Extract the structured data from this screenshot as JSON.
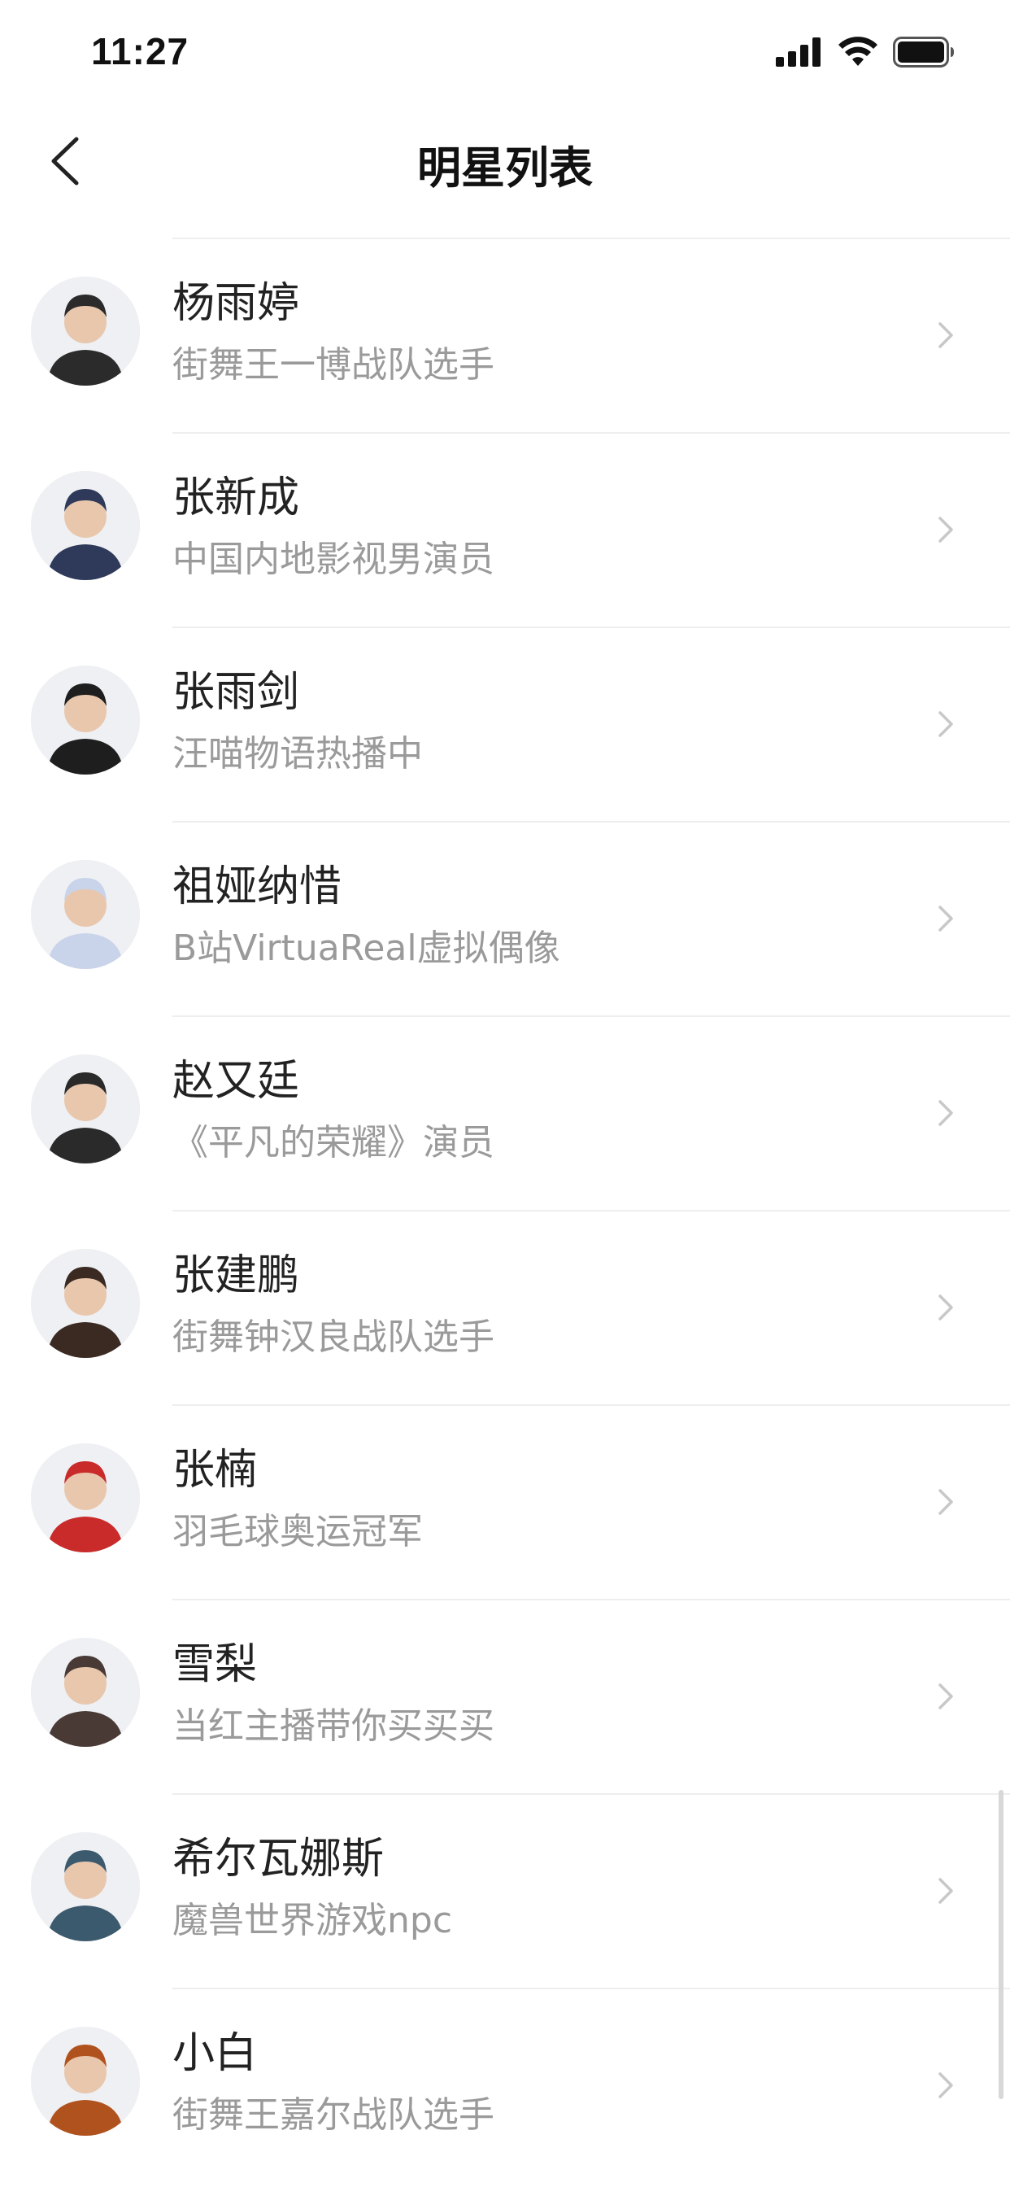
{
  "status_bar": {
    "time": "11:27",
    "icons": [
      "signal-icon",
      "wifi-icon",
      "battery-icon"
    ]
  },
  "nav": {
    "title": "明星列表",
    "back_icon": "chevron-left-icon"
  },
  "list": [
    {
      "name": "杨雨婷",
      "desc": "街舞王一博战队选手",
      "avatar_color": "#2b2b2b"
    },
    {
      "name": "张新成",
      "desc": "中国内地影视男演员",
      "avatar_color": "#2f3a5a"
    },
    {
      "name": "张雨剑",
      "desc": "汪喵物语热播中",
      "avatar_color": "#1e1e1e"
    },
    {
      "name": "祖娅纳惜",
      "desc": "B站VirtuaReal虚拟偶像",
      "avatar_color": "#c9d3ea"
    },
    {
      "name": "赵又廷",
      "desc": "《平凡的荣耀》演员",
      "avatar_color": "#2a2a2a"
    },
    {
      "name": "张建鹏",
      "desc": "街舞钟汉良战队选手",
      "avatar_color": "#3a2a22"
    },
    {
      "name": "张楠",
      "desc": "羽毛球奥运冠军",
      "avatar_color": "#c92a2a"
    },
    {
      "name": "雪梨",
      "desc": "当红主播带你买买买",
      "avatar_color": "#4a3a36"
    },
    {
      "name": "希尔瓦娜斯",
      "desc": "魔兽世界游戏npc",
      "avatar_color": "#3c5a6e"
    },
    {
      "name": "小白",
      "desc": "街舞王嘉尔战队选手",
      "avatar_color": "#b0521e"
    }
  ],
  "colors": {
    "background": "#ffffff",
    "title_text": "#111111",
    "name_text": "#222222",
    "desc_text": "#9a9a9a",
    "divider": "#eeeeee",
    "chevron": "#c8c8c8"
  }
}
